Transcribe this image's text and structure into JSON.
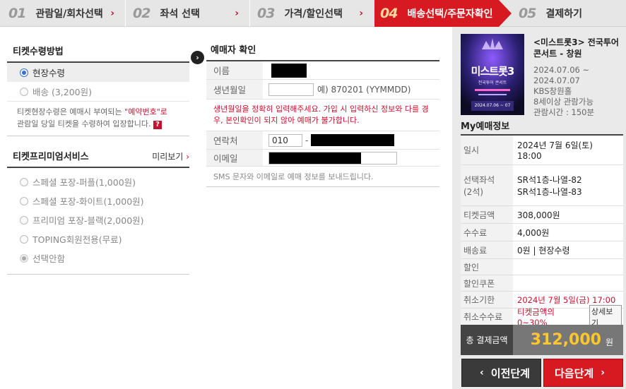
{
  "steps": [
    {
      "num": "01",
      "label": "관람일/회차선택",
      "arrow": "›"
    },
    {
      "num": "02",
      "label": "좌석 선택",
      "arrow": "›"
    },
    {
      "num": "03",
      "label": "가격/할인선택",
      "arrow": "›"
    },
    {
      "num": "04",
      "label": "배송선택/주문자확인"
    },
    {
      "num": "05",
      "label": "결제하기"
    }
  ],
  "delivery": {
    "title": "티켓수령방법",
    "options": [
      {
        "label": "현장수령",
        "selected": true
      },
      {
        "label": "배송 (3,200원)",
        "selected": false
      }
    ],
    "note_prefix": "티켓현장수령은 예매시 부여되는 ",
    "note_highlight": "\"예약번호\"로",
    "note_suffix": "관람일 당일 티켓을 수령하여 입장합니다.",
    "help_icon": "?"
  },
  "premium": {
    "title": "티켓프리미엄서비스",
    "preview_label": "미리보기",
    "preview_arrow": "›",
    "options": [
      {
        "label": "스페셜 포장-퍼플(1,000원)"
      },
      {
        "label": "스페셜 포장-화이트(1,000원)"
      },
      {
        "label": "프리미엄 포장-블랙(2,000원)"
      },
      {
        "label": "TOPING회원전용(무료)"
      },
      {
        "label": "선택안함"
      }
    ]
  },
  "nav_circle": "›",
  "booker": {
    "title": "예매자 확인",
    "name_label": "이름",
    "birth_label": "생년월일",
    "birth_hint": "예) 870201 (YYMMDD)",
    "warning": "생년월일을 정확히 입력해주세요. 가입 시 입력하신 정보와 다를 경우, 본인확인이 되지 않아 예매가 불가합니다.",
    "phone_label": "연락처",
    "phone_prefix": "010",
    "phone_dash": "-",
    "email_label": "이메일",
    "sms_note": "SMS 문자와 이메일로 예매 정보를 보내드립니다."
  },
  "poster": {
    "brand_line": "미스트롯3",
    "title_line": "전국투어 콘서트",
    "date_line": "2024.07.06 ~ 07"
  },
  "event": {
    "title": "<미스트롯3> 전국투어 콘서트 - 창원",
    "dates": "2024.07.06 ~ 2024.07.07",
    "venue": "KBS창원홀",
    "age": "8세이상 관람가능",
    "runtime": "관람시간 : 150분"
  },
  "my": {
    "title": "My예매정보",
    "rows": [
      {
        "k": "일시",
        "v": "2024년 7월 6일(토) 18:00"
      },
      {
        "k": "선택좌석\n(2석)",
        "v": "SR석1층-나열-82\nSR석1층-나열-83"
      },
      {
        "k": "티켓금액",
        "v": "308,000원"
      },
      {
        "k": "수수료",
        "v": "4,000원"
      },
      {
        "k": "배송료",
        "v": "0원 | 현장수령"
      },
      {
        "k": "할인",
        "v": ""
      },
      {
        "k": "할인쿠폰",
        "v": ""
      },
      {
        "k": "취소기한",
        "v": "2024년 7월 5일(금) 17:00"
      },
      {
        "k": "취소수수료",
        "v": "티켓금액의 0~30%"
      }
    ],
    "detail_button": "상세보기",
    "total_label": "총 결제금액",
    "total_value": "312,000",
    "total_unit": "원"
  },
  "buttons": {
    "prev": "이전단계",
    "next": "다음단계",
    "prev_chevron": "‹",
    "next_chevron": "›"
  }
}
